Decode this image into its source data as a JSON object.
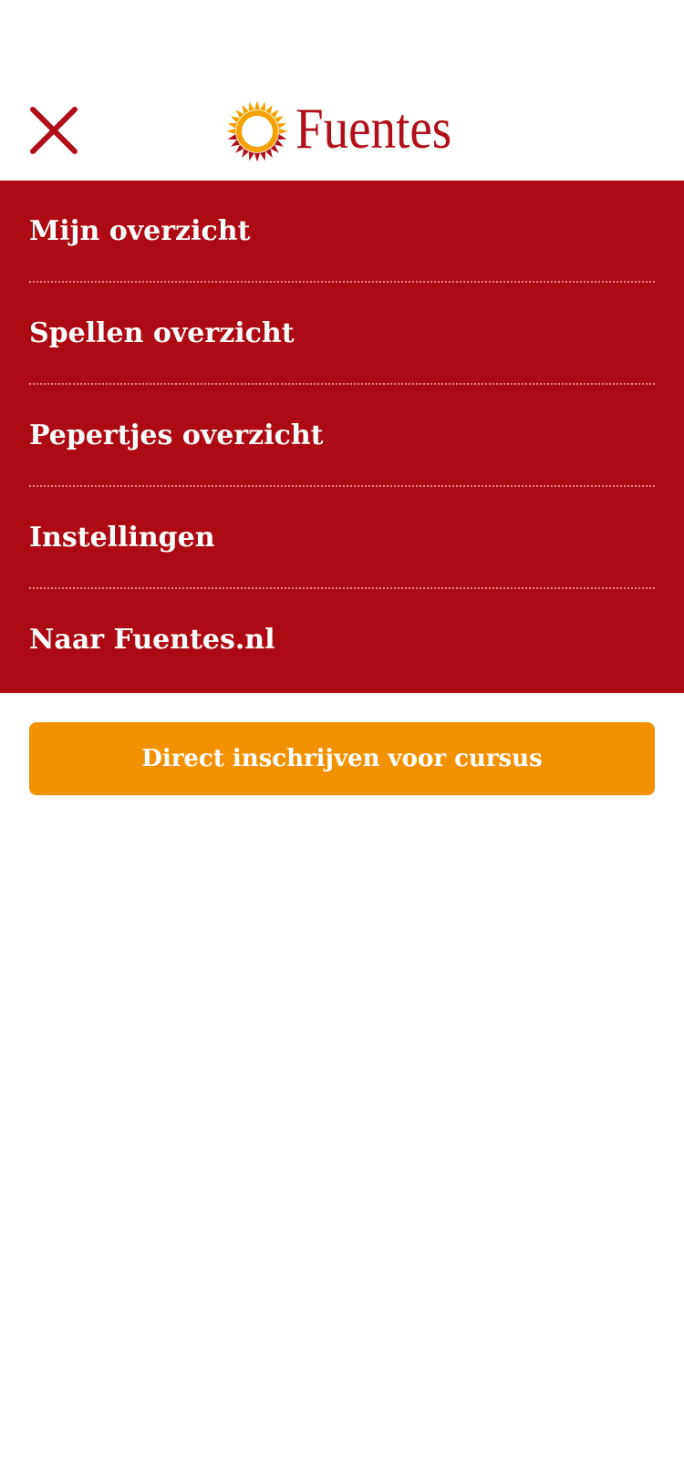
{
  "header": {
    "close_icon": "close-x-icon",
    "logo_text": "Fuentes",
    "logo_icon": "sun-logo-icon"
  },
  "menu": {
    "items": [
      {
        "label": "Mijn overzicht"
      },
      {
        "label": "Spellen overzicht"
      },
      {
        "label": "Pepertjes overzicht"
      },
      {
        "label": "Instellingen"
      },
      {
        "label": "Naar Fuentes.nl"
      }
    ]
  },
  "cta": {
    "label": "Direct inschrijven voor cursus"
  },
  "colors": {
    "brand_red": "#ad0a15",
    "logo_red": "#b00f1a",
    "accent_orange": "#f29200",
    "sun_yellow": "#f5a200",
    "background": "#ffffff"
  }
}
